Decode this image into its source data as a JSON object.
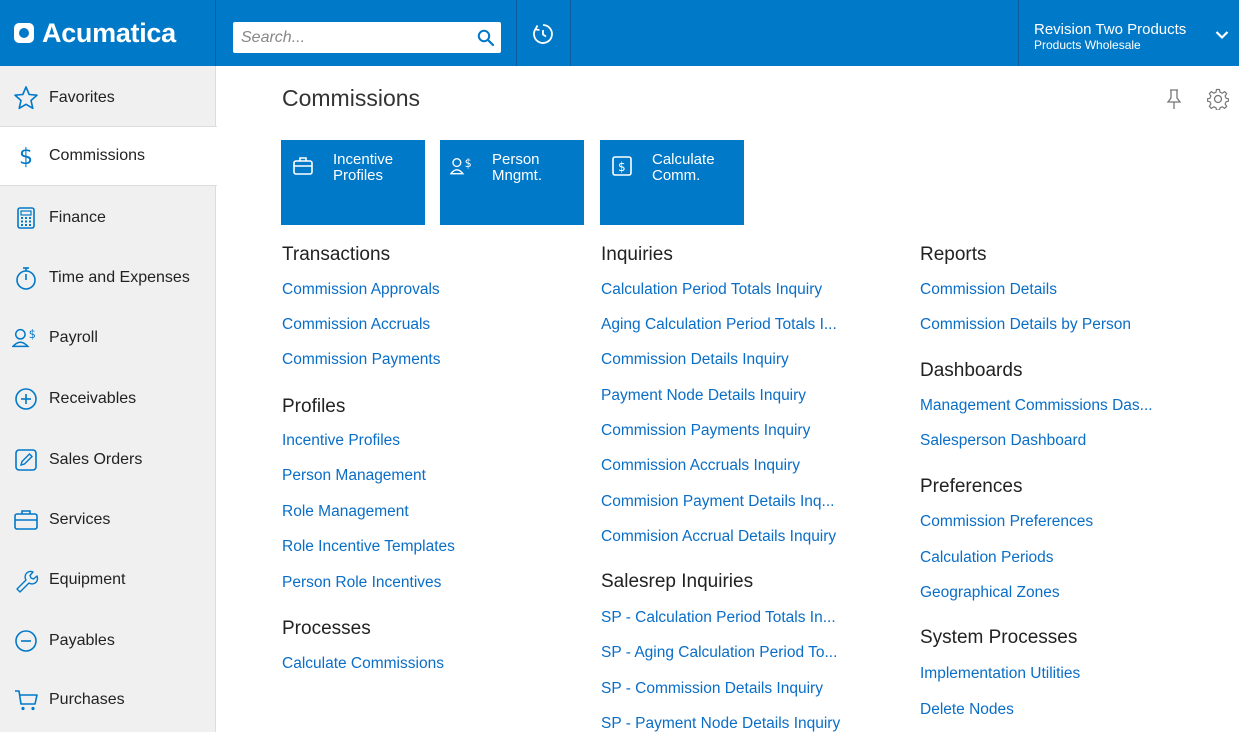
{
  "app": {
    "logo": "Acumatica"
  },
  "header": {
    "search_placeholder": "Search...",
    "company_name": "Revision Two Products",
    "branch_name": "Products Wholesale"
  },
  "sidebar": {
    "items": [
      {
        "label": "Favorites",
        "icon": "star-icon"
      },
      {
        "label": "Commissions",
        "icon": "dollar-icon",
        "active": true
      },
      {
        "label": "Finance",
        "icon": "calculator-icon"
      },
      {
        "label": "Time and Expenses",
        "icon": "stopwatch-icon"
      },
      {
        "label": "Payroll",
        "icon": "person-dollar-icon"
      },
      {
        "label": "Receivables",
        "icon": "plus-circle-icon"
      },
      {
        "label": "Sales Orders",
        "icon": "pencil-box-icon"
      },
      {
        "label": "Services",
        "icon": "briefcase-icon"
      },
      {
        "label": "Equipment",
        "icon": "wrench-icon"
      },
      {
        "label": "Payables",
        "icon": "minus-circle-icon"
      },
      {
        "label": "Purchases",
        "icon": "cart-icon"
      }
    ]
  },
  "main": {
    "title": "Commissions",
    "tiles": [
      {
        "label": "Incentive Profiles",
        "icon": "briefcase-icon"
      },
      {
        "label": "Person Mngmt.",
        "icon": "person-dollar-icon"
      },
      {
        "label": "Calculate Comm.",
        "icon": "dollar-box-icon"
      }
    ],
    "columns": [
      {
        "sections": [
          {
            "title": "Transactions",
            "links": [
              "Commission Approvals",
              "Commission Accruals",
              "Commission Payments"
            ]
          },
          {
            "title": "Profiles",
            "links": [
              "Incentive Profiles",
              "Person Management",
              "Role Management",
              "Role Incentive Templates",
              "Person Role Incentives"
            ]
          },
          {
            "title": "Processes",
            "links": [
              "Calculate Commissions"
            ]
          }
        ]
      },
      {
        "sections": [
          {
            "title": "Inquiries",
            "links": [
              "Calculation Period Totals Inquiry",
              "Aging Calculation Period Totals I...",
              "Commission Details Inquiry",
              "Payment Node Details Inquiry",
              "Commission Payments Inquiry",
              "Commission Accruals Inquiry",
              "Commision Payment Details Inq...",
              "Commision Accrual Details Inquiry"
            ]
          },
          {
            "title": "Salesrep Inquiries",
            "links": [
              "SP - Calculation Period Totals In...",
              "SP - Aging Calculation Period To...",
              "SP - Commission Details Inquiry",
              "SP - Payment Node Details Inquiry"
            ]
          }
        ]
      },
      {
        "sections": [
          {
            "title": "Reports",
            "links": [
              "Commission Details",
              "Commission Details by Person"
            ]
          },
          {
            "title": "Dashboards",
            "links": [
              "Management Commissions Das...",
              "Salesperson Dashboard"
            ]
          },
          {
            "title": "Preferences",
            "links": [
              "Commission Preferences",
              "Calculation Periods",
              "Geographical Zones"
            ]
          },
          {
            "title": "System Processes",
            "links": [
              "Implementation Utilities",
              "Delete Nodes"
            ]
          }
        ]
      }
    ]
  },
  "colors": {
    "brand": "#0079c9",
    "link": "#0a6ec7"
  }
}
